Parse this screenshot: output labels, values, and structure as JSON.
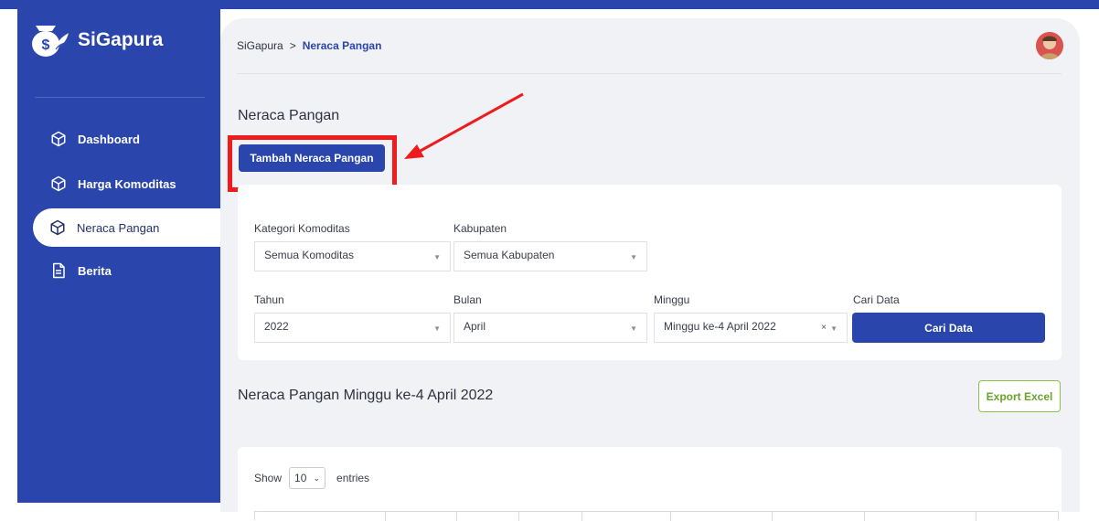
{
  "brand": {
    "name": "SiGapura",
    "icon": "money-bag-leaf-icon"
  },
  "sidebar": {
    "items": [
      {
        "label": "Dashboard",
        "icon": "cube-icon",
        "active": false
      },
      {
        "label": "Harga Komoditas",
        "icon": "cube-icon",
        "active": false
      },
      {
        "label": "Neraca Pangan",
        "icon": "cube-icon",
        "active": true
      },
      {
        "label": "Berita",
        "icon": "document-icon",
        "active": false
      }
    ]
  },
  "breadcrumb": {
    "root": "SiGapura",
    "separator": ">",
    "current": "Neraca Pangan"
  },
  "page": {
    "title": "Neraca Pangan",
    "add_button": "Tambah Neraca Pangan"
  },
  "filters": {
    "kategori": {
      "label": "Kategori Komoditas",
      "value": "Semua Komoditas"
    },
    "kabupaten": {
      "label": "Kabupaten",
      "value": "Semua Kabupaten"
    },
    "tahun": {
      "label": "Tahun",
      "value": "2022"
    },
    "bulan": {
      "label": "Bulan",
      "value": "April"
    },
    "minggu": {
      "label": "Minggu",
      "value": "Minggu ke-4 April 2022",
      "clear": "×"
    },
    "cari": {
      "label": "Cari Data",
      "button": "Cari Data"
    }
  },
  "results": {
    "title": "Neraca Pangan Minggu ke-4 April 2022",
    "export_button": "Export Excel"
  },
  "table": {
    "show_label": "Show",
    "page_length": "10",
    "entries_label": "entries"
  },
  "colors": {
    "primary": "#2a46ad",
    "highlight": "#ee1c1c",
    "export": "#6aa12e"
  }
}
